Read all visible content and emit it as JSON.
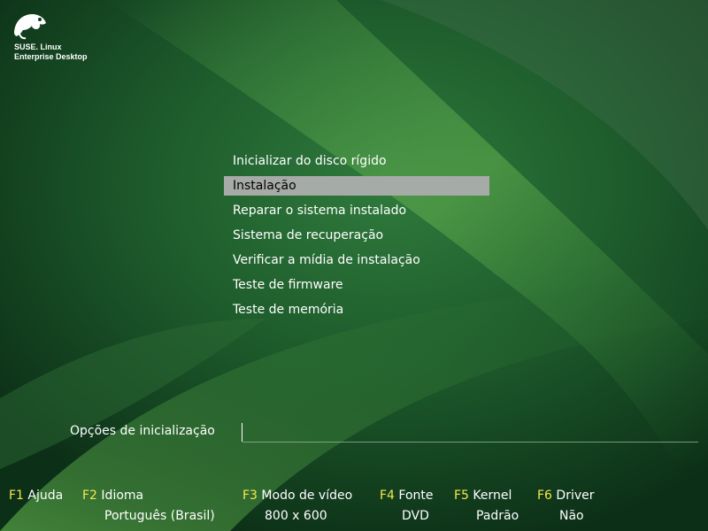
{
  "branding": {
    "line1": "SUSE. Linux",
    "line2": "Enterprise Desktop",
    "icon": "chameleon-logo"
  },
  "menu": {
    "items": [
      {
        "label": "Inicializar do disco rígido",
        "selected": false
      },
      {
        "label": "Instalação",
        "selected": true
      },
      {
        "label": "Reparar o sistema instalado",
        "selected": false
      },
      {
        "label": "Sistema de recuperação",
        "selected": false
      },
      {
        "label": "Verificar a mídia de instalação",
        "selected": false
      },
      {
        "label": "Teste de firmware",
        "selected": false
      },
      {
        "label": "Teste de memória",
        "selected": false
      }
    ]
  },
  "boot_options": {
    "label": "Opções de inicialização",
    "value": ""
  },
  "function_keys": [
    {
      "key": "F1",
      "label": "Ajuda",
      "value": ""
    },
    {
      "key": "F2",
      "label": "Idioma",
      "value": "Português (Brasil)"
    },
    {
      "key": "F3",
      "label": "Modo de vídeo",
      "value": "800 x 600"
    },
    {
      "key": "F4",
      "label": "Fonte",
      "value": "DVD"
    },
    {
      "key": "F5",
      "label": "Kernel",
      "value": "Padrão"
    },
    {
      "key": "F6",
      "label": "Driver",
      "value": "Não"
    }
  ],
  "colors": {
    "background": "#0f3a1f",
    "highlight": "#a7aba8",
    "key_color": "#f5e84a",
    "text": "#ffffff"
  }
}
